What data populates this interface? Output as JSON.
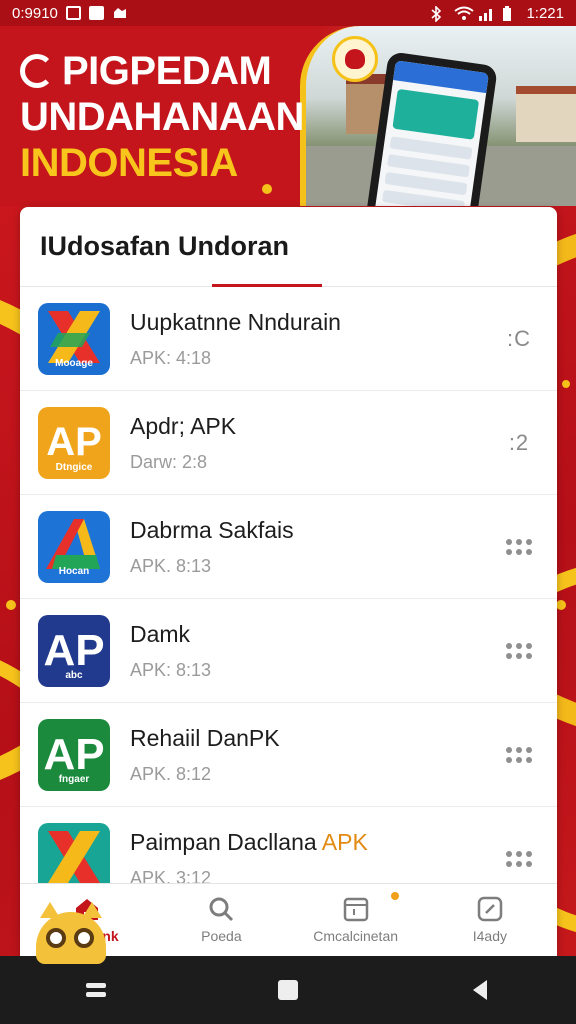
{
  "status_bar": {
    "time": "0:9910"
  },
  "banner": {
    "title_line1": "PIGPEDAM",
    "title_line2": "UNDAHANAAN",
    "title_line3": "INDONESIA"
  },
  "section": {
    "title": "IUdosafan Undoran"
  },
  "apps": [
    {
      "title": "Uupkatnne Nndurain",
      "title_accent": "",
      "subtitle": "APK: 4:18",
      "menu": ":C",
      "icon_name": "app-icon-multicolor-x",
      "icon_caption": "Mooage",
      "icon_bg": "#1b6fd0"
    },
    {
      "title": "Apdr; APK",
      "title_accent": "",
      "subtitle": "Darw: 2:8",
      "menu": ":2",
      "icon_name": "app-icon-orange-ap",
      "icon_caption": "Dtngice",
      "icon_bg": "#f0a41c"
    },
    {
      "title": "Dabrma Sakfais",
      "title_accent": "",
      "subtitle": "APK. 8:13",
      "menu": "",
      "icon_name": "app-icon-blue-a",
      "icon_caption": "Hocan",
      "icon_bg": "#1e74d6"
    },
    {
      "title": "Damk",
      "title_accent": "",
      "subtitle": "APK: 8:13",
      "menu": "",
      "icon_name": "app-icon-navy-ap",
      "icon_caption": "abc",
      "icon_bg": "#223a8e"
    },
    {
      "title": "Rehaiil DanPK",
      "title_accent": "",
      "subtitle": "APK. 8:12",
      "menu": "",
      "icon_name": "app-icon-green-ap",
      "icon_caption": "fngaer",
      "icon_bg": "#1b8a3d"
    },
    {
      "title": "Paimpan Dacllana",
      "title_accent": "APK",
      "subtitle": "APK. 3:12",
      "menu": "",
      "icon_name": "app-icon-teal-x",
      "icon_caption": "",
      "icon_bg": "#18a596"
    }
  ],
  "bottom_nav": [
    {
      "label": "Nenpiank",
      "icon": "home-icon",
      "active": true
    },
    {
      "label": "Poeda",
      "icon": "search-icon",
      "active": false
    },
    {
      "label": "Cmcalcinetan",
      "icon": "calendar-icon",
      "active": false
    },
    {
      "label": "I4ady",
      "icon": "clock-icon",
      "active": false
    }
  ],
  "colors": {
    "primary_red": "#c3151b",
    "accent_yellow": "#f6c21c",
    "nav_bar": "#1c1c1c"
  }
}
